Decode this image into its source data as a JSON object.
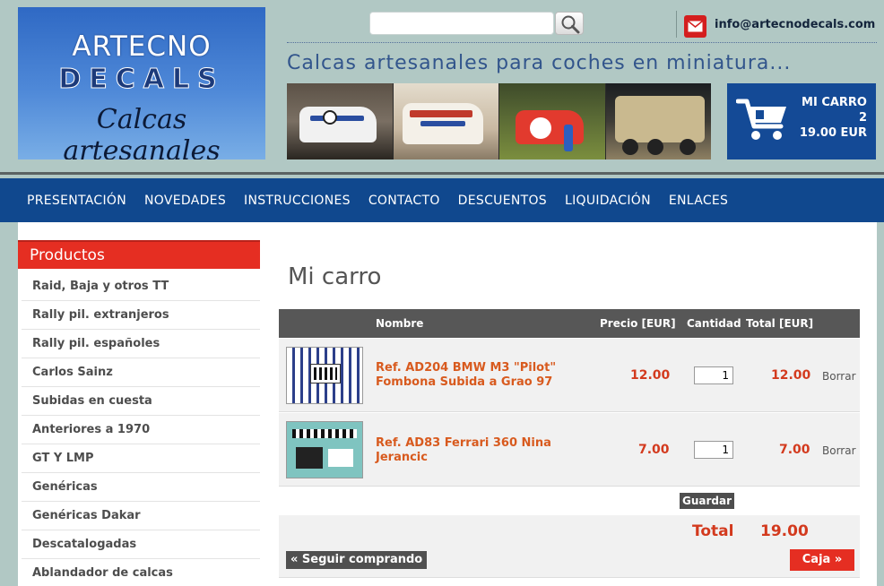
{
  "logo": {
    "line1": "ARTECNO",
    "line2": "DECALS",
    "line3": "Calcas artesanales"
  },
  "search": {
    "value": "",
    "placeholder": ""
  },
  "contact": {
    "email": "info@artecnodecals.com"
  },
  "tagline": "Calcas artesanales para coches en miniatura...",
  "mini_cart": {
    "label": "MI CARRO",
    "count": "2",
    "amount": "19.00 EUR"
  },
  "nav": [
    "PRESENTACIÓN",
    "NOVEDADES",
    "INSTRUCCIONES",
    "CONTACTO",
    "DESCUENTOS",
    "LIQUIDACIÓN",
    "ENLACES"
  ],
  "sidebar": {
    "title": "Productos",
    "items": [
      "Raid, Baja y otros TT",
      "Rally pil. extranjeros",
      "Rally pil. españoles",
      "Carlos Sainz",
      "Subidas en cuesta",
      "Anteriores a 1970",
      "GT Y LMP",
      "Genéricas",
      "Genéricas Dakar",
      "Descatalogadas",
      "Ablandador de calcas"
    ]
  },
  "page_title": "Mi carro",
  "table": {
    "headers": {
      "name": "Nombre",
      "price": "Precio [EUR]",
      "qty": "Cantidad",
      "total": "Total [EUR]"
    },
    "rows": [
      {
        "name": "Ref. AD204 BMW M3 \"Pilot\" Fombona Subida a Grao 97",
        "price": "12.00",
        "qty": "1",
        "total": "12.00",
        "delete": "Borrar"
      },
      {
        "name": "Ref. AD83 Ferrari 360 Nina Jerancic",
        "price": "7.00",
        "qty": "1",
        "total": "7.00",
        "delete": "Borrar"
      }
    ],
    "save_label": "Guardar",
    "total_label": "Total",
    "total_value": "19.00",
    "continue_label": "« Seguir comprando",
    "checkout_label": "Caja »"
  },
  "colors": {
    "nav_blue": "#10488e",
    "accent_red": "#e52e22",
    "price_red": "#d33a1e",
    "page_bg": "#b1c8c4"
  }
}
